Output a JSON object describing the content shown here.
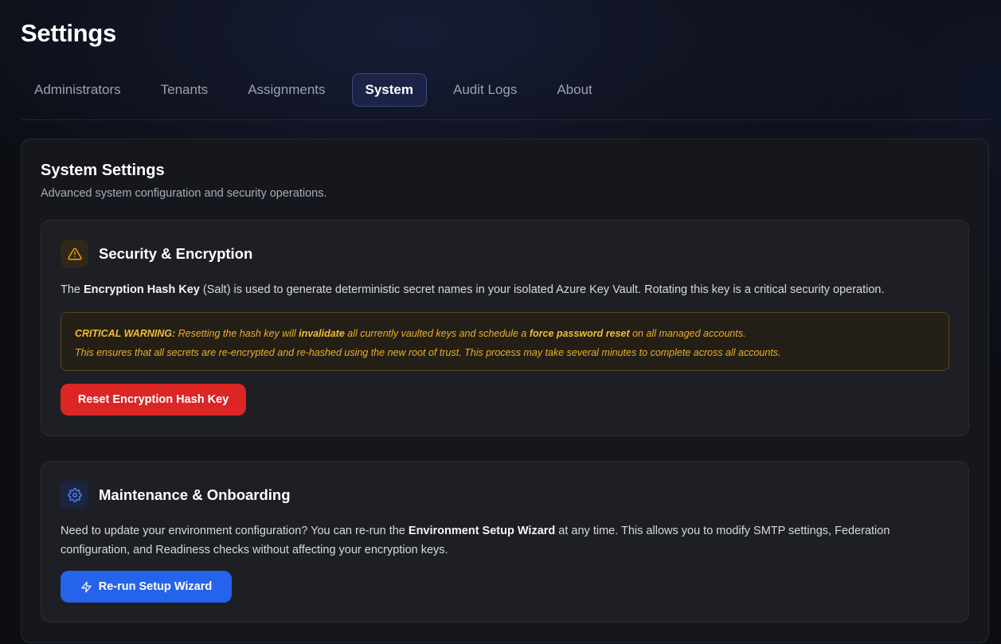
{
  "page": {
    "title": "Settings"
  },
  "tabs": [
    {
      "label": "Administrators",
      "active": false
    },
    {
      "label": "Tenants",
      "active": false
    },
    {
      "label": "Assignments",
      "active": false
    },
    {
      "label": "System",
      "active": true
    },
    {
      "label": "Audit Logs",
      "active": false
    },
    {
      "label": "About",
      "active": false
    }
  ],
  "system": {
    "title": "System Settings",
    "subtitle": "Advanced system configuration and security operations.",
    "security": {
      "icon": "warning-triangle-icon",
      "title": "Security & Encryption",
      "desc_pre": "The ",
      "desc_bold": "Encryption Hash Key",
      "desc_post": " (Salt) is used to generate deterministic secret names in your isolated Azure Key Vault. Rotating this key is a critical security operation.",
      "warning": {
        "label": "CRITICAL WARNING:",
        "line1_a": " Resetting the hash key will ",
        "line1_b": "invalidate",
        "line1_c": " all currently vaulted keys and schedule a ",
        "line1_d": "force password reset",
        "line1_e": " on all managed accounts.",
        "line2": "This ensures that all secrets are re-encrypted and re-hashed using the new root of trust. This process may take several minutes to complete across all accounts."
      },
      "button_label": "Reset Encryption Hash Key"
    },
    "maintenance": {
      "icon": "gear-icon",
      "title": "Maintenance & Onboarding",
      "desc_pre": "Need to update your environment configuration? You can re-run the ",
      "desc_bold": "Environment Setup Wizard",
      "desc_post": " at any time. This allows you to modify SMTP settings, Federation configuration, and Readiness checks without affecting your encryption keys.",
      "button_icon": "lightning-bolt-icon",
      "button_label": "Re-run Setup Wizard"
    }
  },
  "colors": {
    "background": "#0c0e14",
    "card": "#15171d",
    "section": "#1d1f25",
    "active_tab": "#1b2447",
    "danger": "#dc2626",
    "primary": "#2563eb",
    "warning_text": "#e9b02a"
  }
}
